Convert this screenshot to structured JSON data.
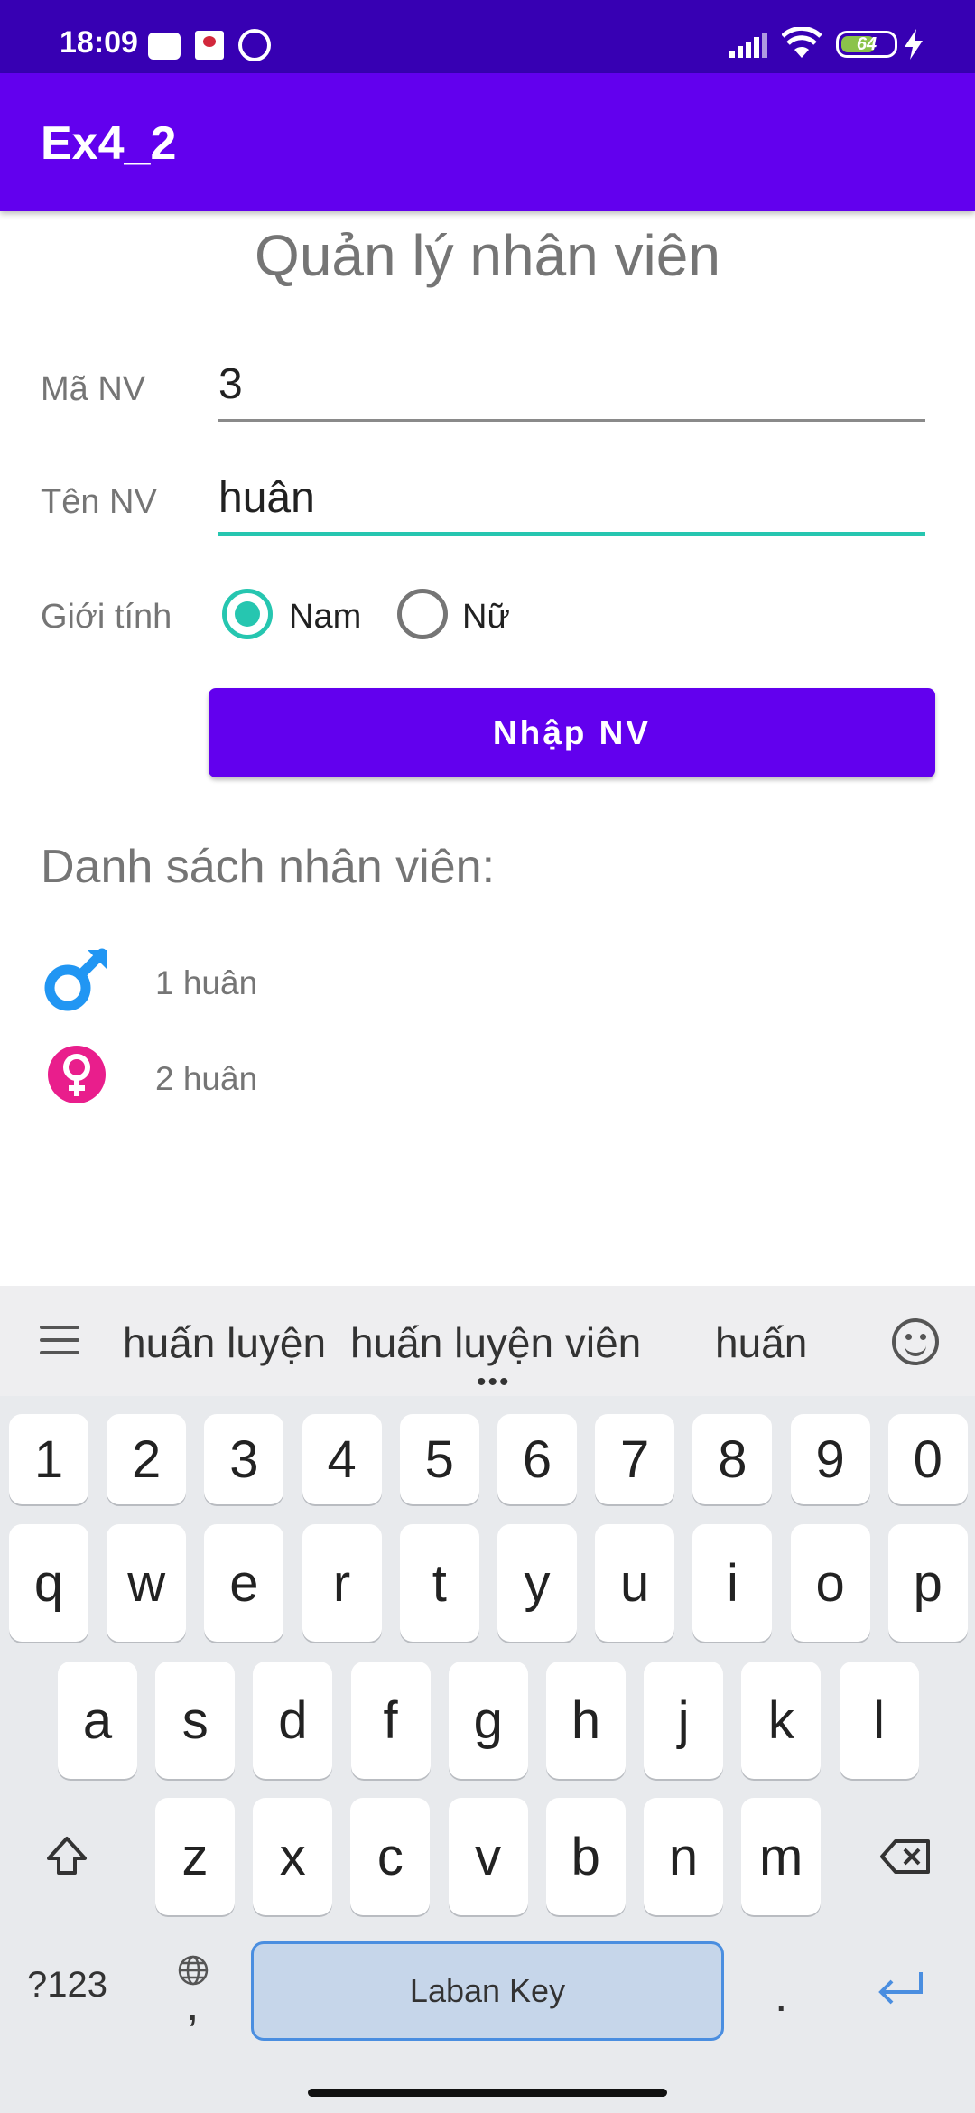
{
  "status_bar": {
    "time": "18:09",
    "battery": "64",
    "icons": [
      "message-icon",
      "calendar-app-icon",
      "sync-icon",
      "signal-icon",
      "wifi-icon",
      "battery-icon",
      "charging-icon"
    ]
  },
  "app_bar": {
    "title": "Ex4_2"
  },
  "form": {
    "heading": "Quản lý nhân viên",
    "ma_nv_label": "Mã NV",
    "ma_nv_value": "3",
    "ten_nv_label": "Tên NV",
    "ten_nv_value": "huân",
    "gioi_tinh_label": "Giới tính",
    "radio_male": "Nam",
    "radio_female": "Nữ",
    "selected": "Nam",
    "submit_label": "Nhập NV"
  },
  "list": {
    "title": "Danh sách nhân viên:",
    "items": [
      {
        "text": "1 huân",
        "gender_icon": "male-icon"
      },
      {
        "text": "2 huân",
        "gender_icon": "female-icon"
      }
    ]
  },
  "keyboard": {
    "suggestions": [
      "huấn luyện",
      "huấn luyện viên",
      "huấn"
    ],
    "row_numbers": [
      "1",
      "2",
      "3",
      "4",
      "5",
      "6",
      "7",
      "8",
      "9",
      "0"
    ],
    "row1": [
      "q",
      "w",
      "e",
      "r",
      "t",
      "y",
      "u",
      "i",
      "o",
      "p"
    ],
    "row2": [
      "a",
      "s",
      "d",
      "f",
      "g",
      "h",
      "j",
      "k",
      "l"
    ],
    "row3": [
      "z",
      "x",
      "c",
      "v",
      "b",
      "n",
      "m"
    ],
    "symbols_key": "?123",
    "comma_key": ",",
    "space_label": "Laban Key",
    "period_key": ".",
    "colors": {
      "accent": "#6200ee",
      "status_bar": "#3700b3",
      "radio": "#26c6b0"
    }
  }
}
